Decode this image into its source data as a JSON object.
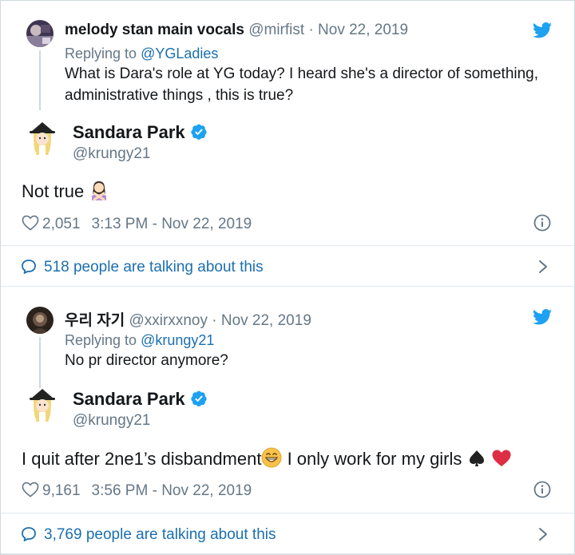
{
  "tweets": [
    {
      "reply": {
        "name": "melody stan main vocals",
        "handle": "@mirfist",
        "date": "· Nov 22, 2019",
        "replying_prefix": "Replying to ",
        "replying_to": "@YGLadies",
        "text": "What is Dara's role at YG today? I heard she's a director of something, administrative things , this is true?"
      },
      "main": {
        "name": "Sandara Park",
        "handle": "@krungy21",
        "text": "Not true",
        "likes": "2,051",
        "timestamp": "3:13 PM - Nov 22, 2019"
      },
      "talking": "518 people are talking about this"
    },
    {
      "reply": {
        "name": "우리 자기",
        "handle": "@xxirxxnoy",
        "date": "· Nov 22, 2019",
        "replying_prefix": "Replying to ",
        "replying_to": "@krungy21",
        "text": "No pr director anymore?"
      },
      "main": {
        "name": "Sandara Park",
        "handle": "@krungy21",
        "text_part1": "I quit after 2ne1’s disbandment",
        "text_part2": " I only work for my girls",
        "likes": "9,161",
        "timestamp": "3:56 PM - Nov 22, 2019"
      },
      "talking": "3,769 people are talking about this"
    }
  ],
  "colors": {
    "link": "#1b6fb0",
    "twitter_blue": "#1da1f2",
    "muted": "#657786",
    "text": "#14171a"
  },
  "icons": [
    "twitter-bird-icon",
    "verified-badge-icon",
    "heart-icon",
    "info-icon",
    "speech-bubble-icon",
    "chevron-right-icon",
    "woman-gesturing-no-emoji",
    "grinning-face-emoji",
    "spade-suit-emoji",
    "red-heart-emoji"
  ]
}
